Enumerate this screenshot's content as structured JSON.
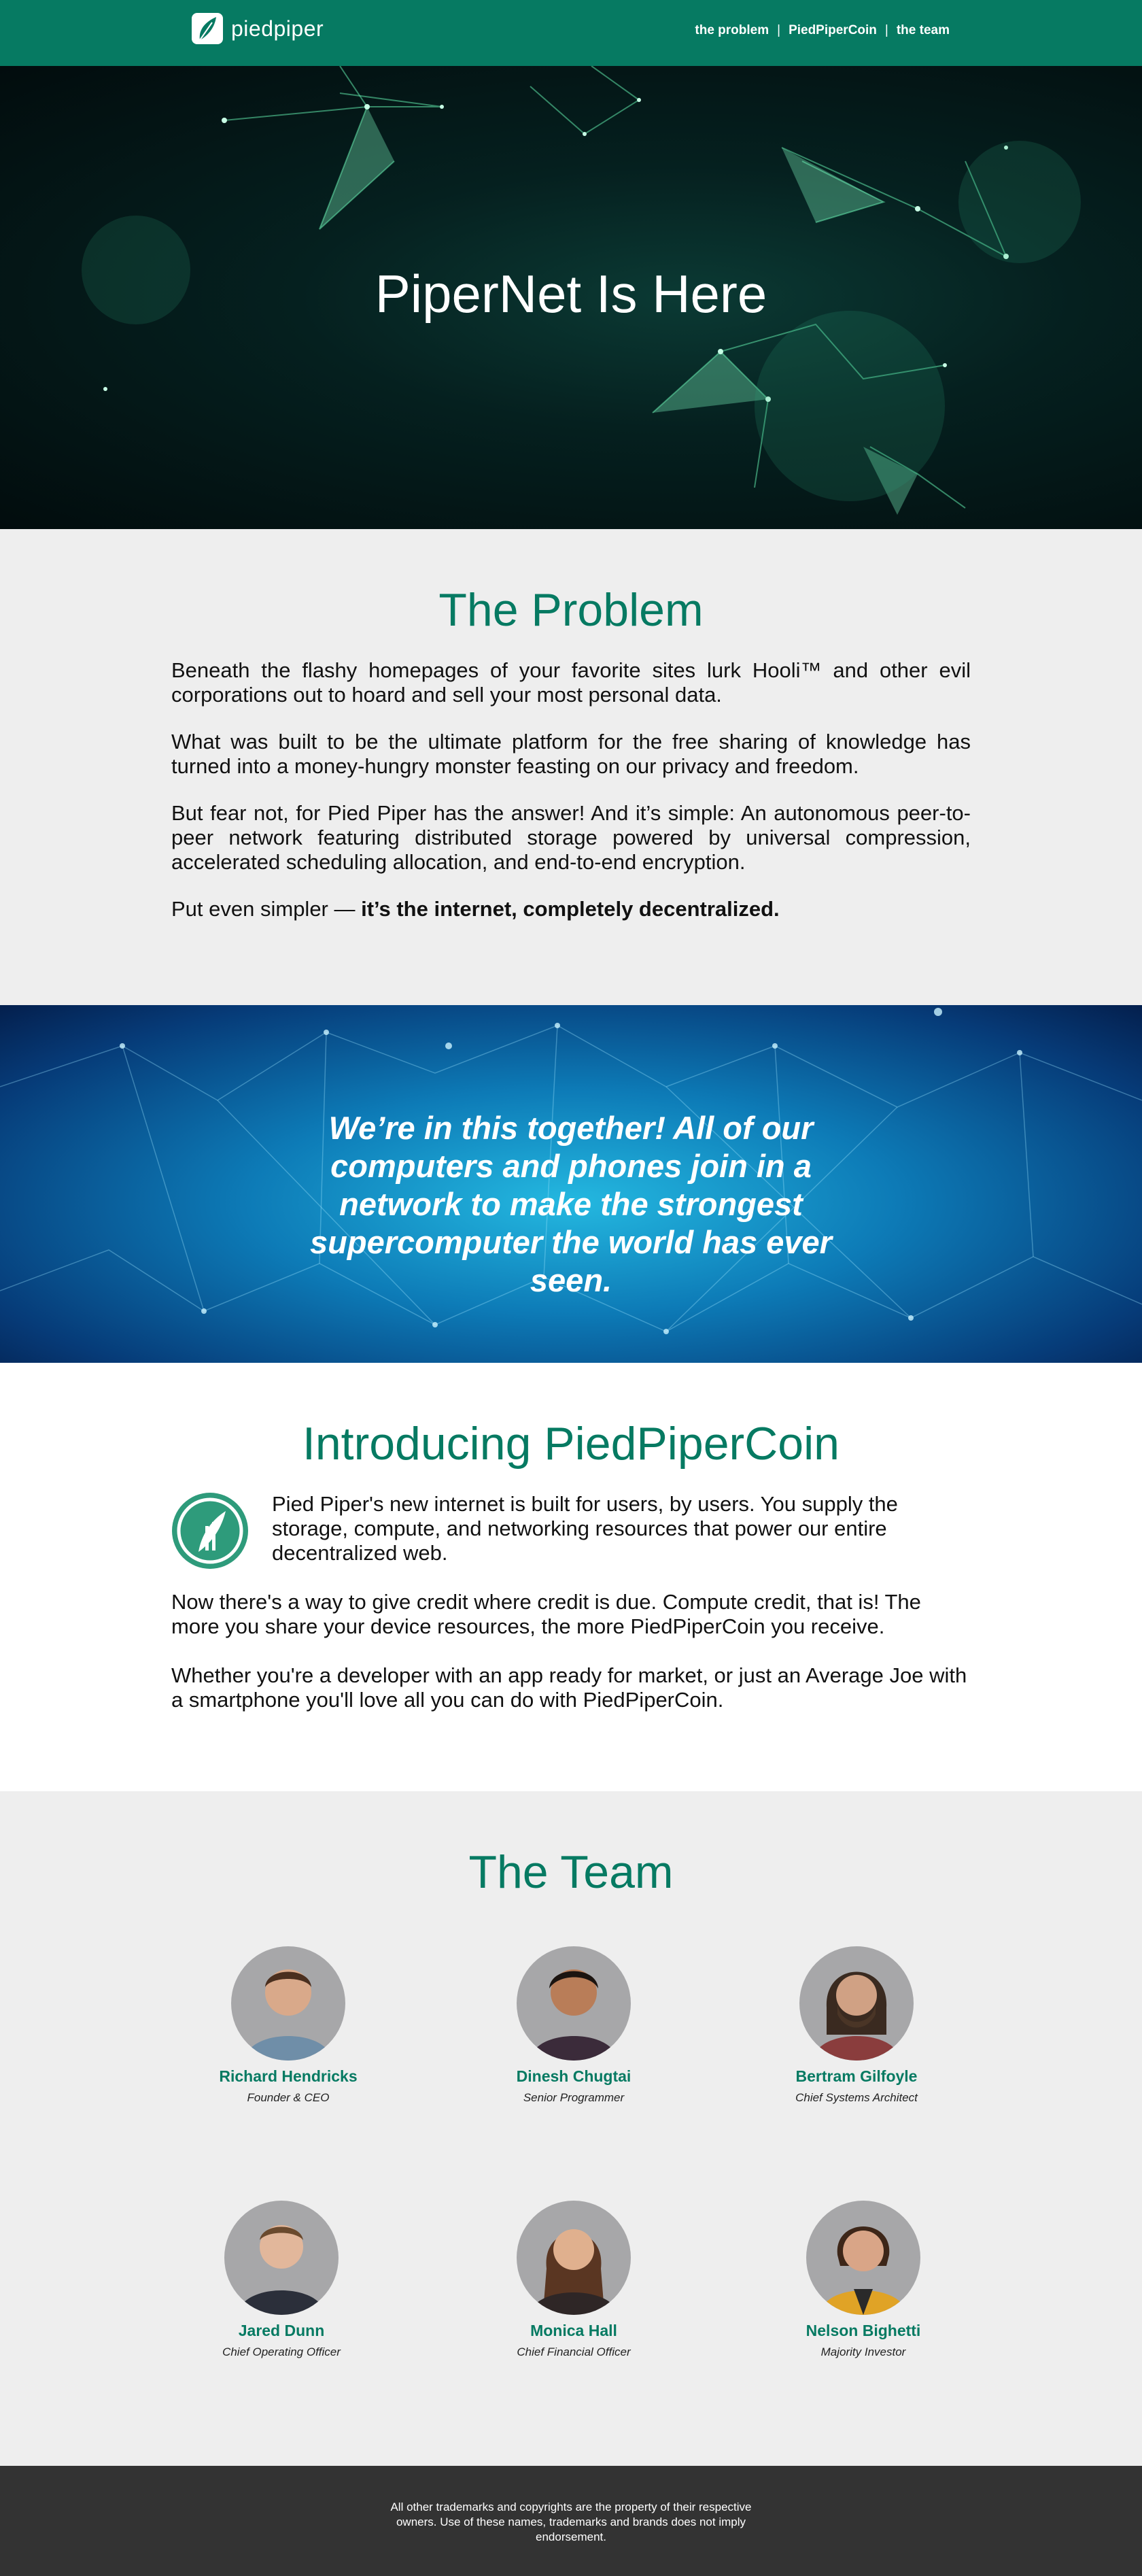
{
  "nav": {
    "logo_text": "piedpiper",
    "links": [
      "the problem",
      "PiedPiperCoin",
      "the team"
    ],
    "separator": "|"
  },
  "hero": {
    "title": "PiperNet Is Here"
  },
  "problem": {
    "title": "The Problem",
    "paragraphs": [
      "Beneath the flashy homepages of your favorite sites lurk Hooli™ and other evil corporations out to hoard and sell your most personal data.",
      "What was built to be the ultimate platform for the free sharing of knowledge has turned into a money-hungry monster feasting on our privacy and freedom.",
      "But fear not, for Pied Piper has the answer! And it’s simple: An autonomous peer-to-peer network featuring distributed storage powered by universal compression, accelerated scheduling allocation, and end-to-end encryption."
    ],
    "last_prefix": "Put even simpler — ",
    "last_bold": "it’s the internet, completely decentralized."
  },
  "quote": {
    "text": "We’re in this together! All of our computers and phones join in a network to make the strongest supercomputer the world has ever seen."
  },
  "coin": {
    "title": "Introducing PiedPiperCoin",
    "lead": "Pied Piper's new internet is built for users, by users. You supply the storage, compute, and networking resources that power our entire decentralized web.",
    "paragraphs": [
      "Now there's a way to give credit where credit is due. Compute credit, that is! The more you share your device resources, the more PiedPiperCoin you receive.",
      "Whether you're a developer with an app ready for market, or just an Average Joe with a smartphone you'll love all you can do with PiedPiperCoin."
    ]
  },
  "team": {
    "title": "The Team",
    "members": [
      {
        "name": "Richard Hendricks",
        "role": "Founder & CEO"
      },
      {
        "name": "Dinesh Chugtai",
        "role": "Senior Programmer"
      },
      {
        "name": "Bertram Gilfoyle",
        "role": "Chief Systems Architect"
      },
      {
        "name": "Jared Dunn",
        "role": "Chief Operating Officer"
      },
      {
        "name": "Monica Hall",
        "role": "Chief Financial Officer"
      },
      {
        "name": "Nelson Bighetti",
        "role": "Majority Investor"
      }
    ]
  },
  "footer": {
    "text": "All other trademarks and copyrights are the property of their respective owners. Use of these names, trademarks and brands does not imply endorsement."
  },
  "colors": {
    "brand_green": "#067a62",
    "footer_bg": "#333333",
    "section_gray": "#eeeeee"
  }
}
